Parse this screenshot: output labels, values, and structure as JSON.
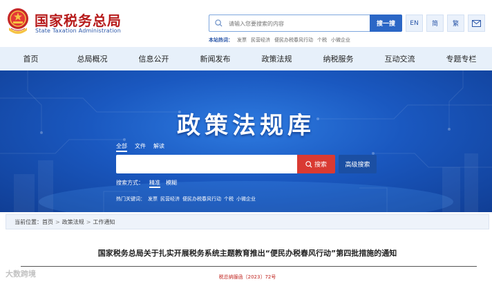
{
  "header": {
    "logo_cn": "国家税务总局",
    "logo_en": "State Taxation Administration",
    "search_placeholder": "请输入您要搜索的内容",
    "search_button": "搜一搜",
    "util": {
      "en": "EN",
      "simplified": "简",
      "traditional": "繁",
      "mail_icon": "mail-icon"
    },
    "hot_label": "本站热词：",
    "hot_words": [
      "发票",
      "民营经济",
      "便民办税春风行动",
      "个税",
      "小微企业"
    ]
  },
  "nav": {
    "items": [
      "首页",
      "总局概况",
      "信息公开",
      "新闻发布",
      "政策法规",
      "纳税服务",
      "互动交流",
      "专题专栏"
    ]
  },
  "banner": {
    "title": "政策法规库",
    "scope_tabs": [
      "全部",
      "文件",
      "解读"
    ],
    "search_button": "搜索",
    "advanced_button": "高级搜索",
    "mode_label": "搜索方式：",
    "modes": [
      "精准",
      "模糊"
    ],
    "hot_label": "热门关键词：",
    "hot_words": [
      "发票",
      "民营经济",
      "便民办税春风行动",
      "个税",
      "小微企业"
    ]
  },
  "breadcrumb": {
    "label": "当前位置：",
    "items": [
      "首页",
      "政策法规",
      "工作通知"
    ]
  },
  "article": {
    "title": "国家税务总局关于扎实开展税务系统主题教育推出“便民办税春风行动”第四批措施的通知",
    "doc_number": "税总纳服函〔2023〕72号"
  },
  "watermark": "大数跨境",
  "colors": {
    "brand_red": "#b71c1c",
    "primary_blue": "#2b67c6",
    "nav_bg": "#e7f0fa",
    "search_red": "#d93a32"
  }
}
